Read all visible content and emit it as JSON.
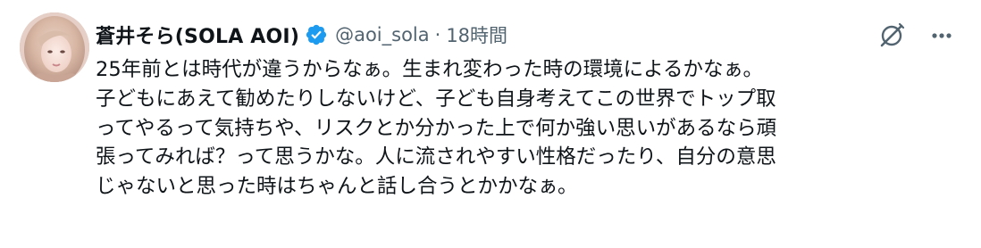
{
  "tweet": {
    "author": {
      "display_name": "蒼井そら(SOLA AOI)",
      "handle": "@aoi_sola",
      "verified": true,
      "avatar_icon": "profile-photo"
    },
    "separator": "·",
    "timestamp": "18時間",
    "lines": [
      "25年前とは時代が違うからなぁ。生まれ変わった時の環境によるかなぁ。",
      "子どもにあえて勧めたりしないけど、子ども自身考えてこの世界でトップ取",
      "ってやるって気持ちや、リスクとか分かった上で何か強い思いがあるなら頑",
      "張ってみれば？って思うかな。人に流されやすい性格だったり、自分の意思",
      "じゃないと思った時はちゃんと話し合うとかかなぁ。"
    ]
  },
  "actions": {
    "grok_icon": "grok-icon",
    "more_icon": "more-icon"
  },
  "colors": {
    "text_primary": "#0f1419",
    "text_secondary": "#536471",
    "verified_blue": "#1d9bf0",
    "background": "#ffffff"
  }
}
